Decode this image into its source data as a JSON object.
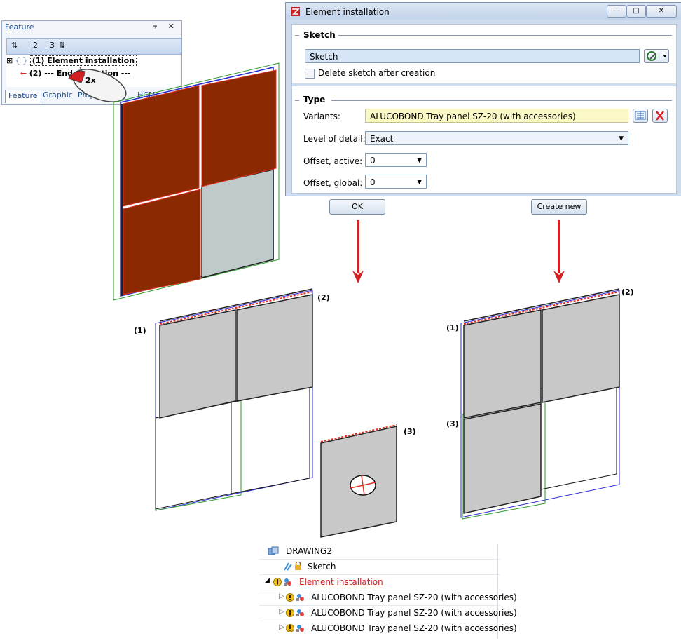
{
  "feature_panel": {
    "title": "Feature",
    "pin_glyph": "⫧",
    "close_glyph": "✕",
    "toolbar": [
      "⋮",
      "⋮2",
      "⋮3",
      "⋮"
    ],
    "toolbar_labels": [
      "2",
      "3"
    ],
    "tree": [
      {
        "expander": "⊞",
        "glyph": "{ }",
        "label": "(1) Element installation"
      },
      {
        "glyph": "←",
        "label": "(2) --- End of section ---"
      }
    ],
    "tabs": [
      "Feature",
      "Graphic",
      "Proper",
      "HCM"
    ]
  },
  "mouse": {
    "label": "2x"
  },
  "dialog": {
    "title": "Element installation",
    "window_buttons": [
      "—",
      "□",
      "✕"
    ],
    "sketch_group": {
      "heading": "Sketch",
      "field_value": "Sketch",
      "checkbox_label": "Delete sketch after creation",
      "checkbox_checked": false
    },
    "type_group": {
      "heading": "Type",
      "variants_label": "Variants:",
      "variants_value": "ALUCOBOND Tray panel SZ-20 (with accessories)",
      "lod_label": "Level of detail:",
      "lod_value": "Exact",
      "offset_active_label": "Offset, active:",
      "offset_active_value": "0",
      "offset_global_label": "Offset, global:",
      "offset_global_value": "0"
    }
  },
  "buttons": {
    "ok": "OK",
    "create_new": "Create new"
  },
  "callouts": {
    "left": {
      "c1": "(1)",
      "c2": "(2)"
    },
    "middle": {
      "c3": "(3)"
    },
    "right": {
      "c1": "(1)",
      "c2": "(2)",
      "c3": "(3)"
    }
  },
  "model_tree": {
    "root": "DRAWING2",
    "sketch": "Sketch",
    "element": "Element installation",
    "children": [
      "ALUCOBOND Tray panel SZ-20 (with accessories)",
      "ALUCOBOND Tray panel SZ-20 (with accessories)",
      "ALUCOBOND Tray panel SZ-20 (with accessories)"
    ]
  },
  "colors": {
    "panel_rust": "#8b2a02",
    "panel_grey": "#c8c8c8",
    "edge_blue": "#2a2ad0",
    "edge_green": "#2a9a2a",
    "edge_red": "#e03020",
    "arrow_red": "#d42020",
    "variants_bg": "#fbf8c8",
    "sketch_bg": "#d7e6f7"
  }
}
